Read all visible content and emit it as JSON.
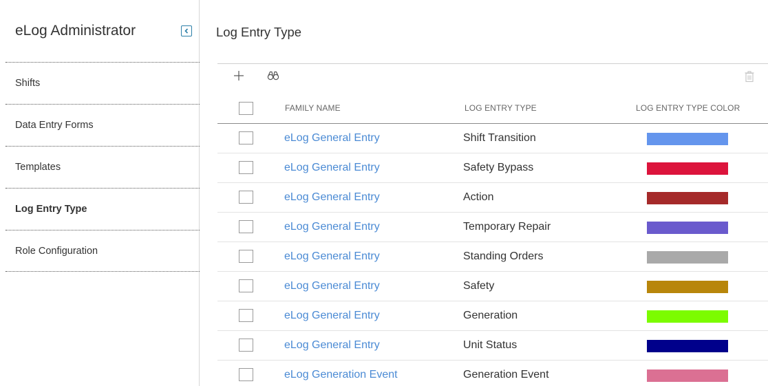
{
  "sidebar": {
    "title": "eLog Administrator",
    "collapse_icon": "chevron-left-icon",
    "items": [
      {
        "label": "Shifts",
        "active": false
      },
      {
        "label": "Data Entry Forms",
        "active": false
      },
      {
        "label": "Templates",
        "active": false
      },
      {
        "label": "Log Entry Type",
        "active": true
      },
      {
        "label": "Role Configuration",
        "active": false
      }
    ]
  },
  "main": {
    "title": "Log Entry Type",
    "toolbar": {
      "add_icon": "plus-icon",
      "find_icon": "binoculars-icon",
      "delete_icon": "trash-icon"
    },
    "columns": [
      "FAMILY NAME",
      "LOG ENTRY TYPE",
      "LOG ENTRY TYPE COLOR"
    ],
    "rows": [
      {
        "family": "eLog General Entry",
        "type": "Shift Transition",
        "color": "#6495ed"
      },
      {
        "family": "eLog General Entry",
        "type": "Safety Bypass",
        "color": "#dc143c"
      },
      {
        "family": "eLog General Entry",
        "type": "Action",
        "color": "#a52a2a"
      },
      {
        "family": "eLog General Entry",
        "type": "Temporary Repair",
        "color": "#6a5acd"
      },
      {
        "family": "eLog General Entry",
        "type": "Standing Orders",
        "color": "#a9a9a9"
      },
      {
        "family": "eLog General Entry",
        "type": "Safety",
        "color": "#b8860b"
      },
      {
        "family": "eLog General Entry",
        "type": "Generation",
        "color": "#7cfc00"
      },
      {
        "family": "eLog General Entry",
        "type": "Unit Status",
        "color": "#00008b"
      },
      {
        "family": "eLog Generation Event",
        "type": "Generation Event",
        "color": "#db7093"
      }
    ]
  },
  "colors": {
    "link": "#4a8ad4",
    "accent": "#2b7fa8"
  }
}
